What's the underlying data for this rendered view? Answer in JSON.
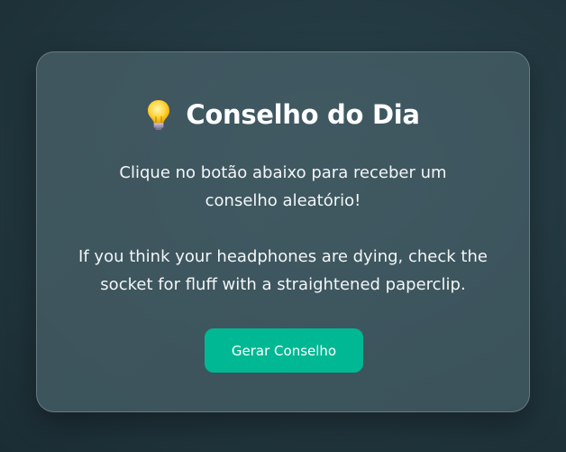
{
  "card": {
    "title": "Conselho do Dia",
    "title_icon": "lightbulb-icon",
    "intro": "Clique no botão abaixo para receber um conselho aleatório!",
    "advice": "If you think your headphones are dying, check the socket for fluff with a straightened paperclip.",
    "button_label": "Gerar Conselho"
  },
  "colors": {
    "button": "#00b894",
    "background": "#22373f"
  }
}
